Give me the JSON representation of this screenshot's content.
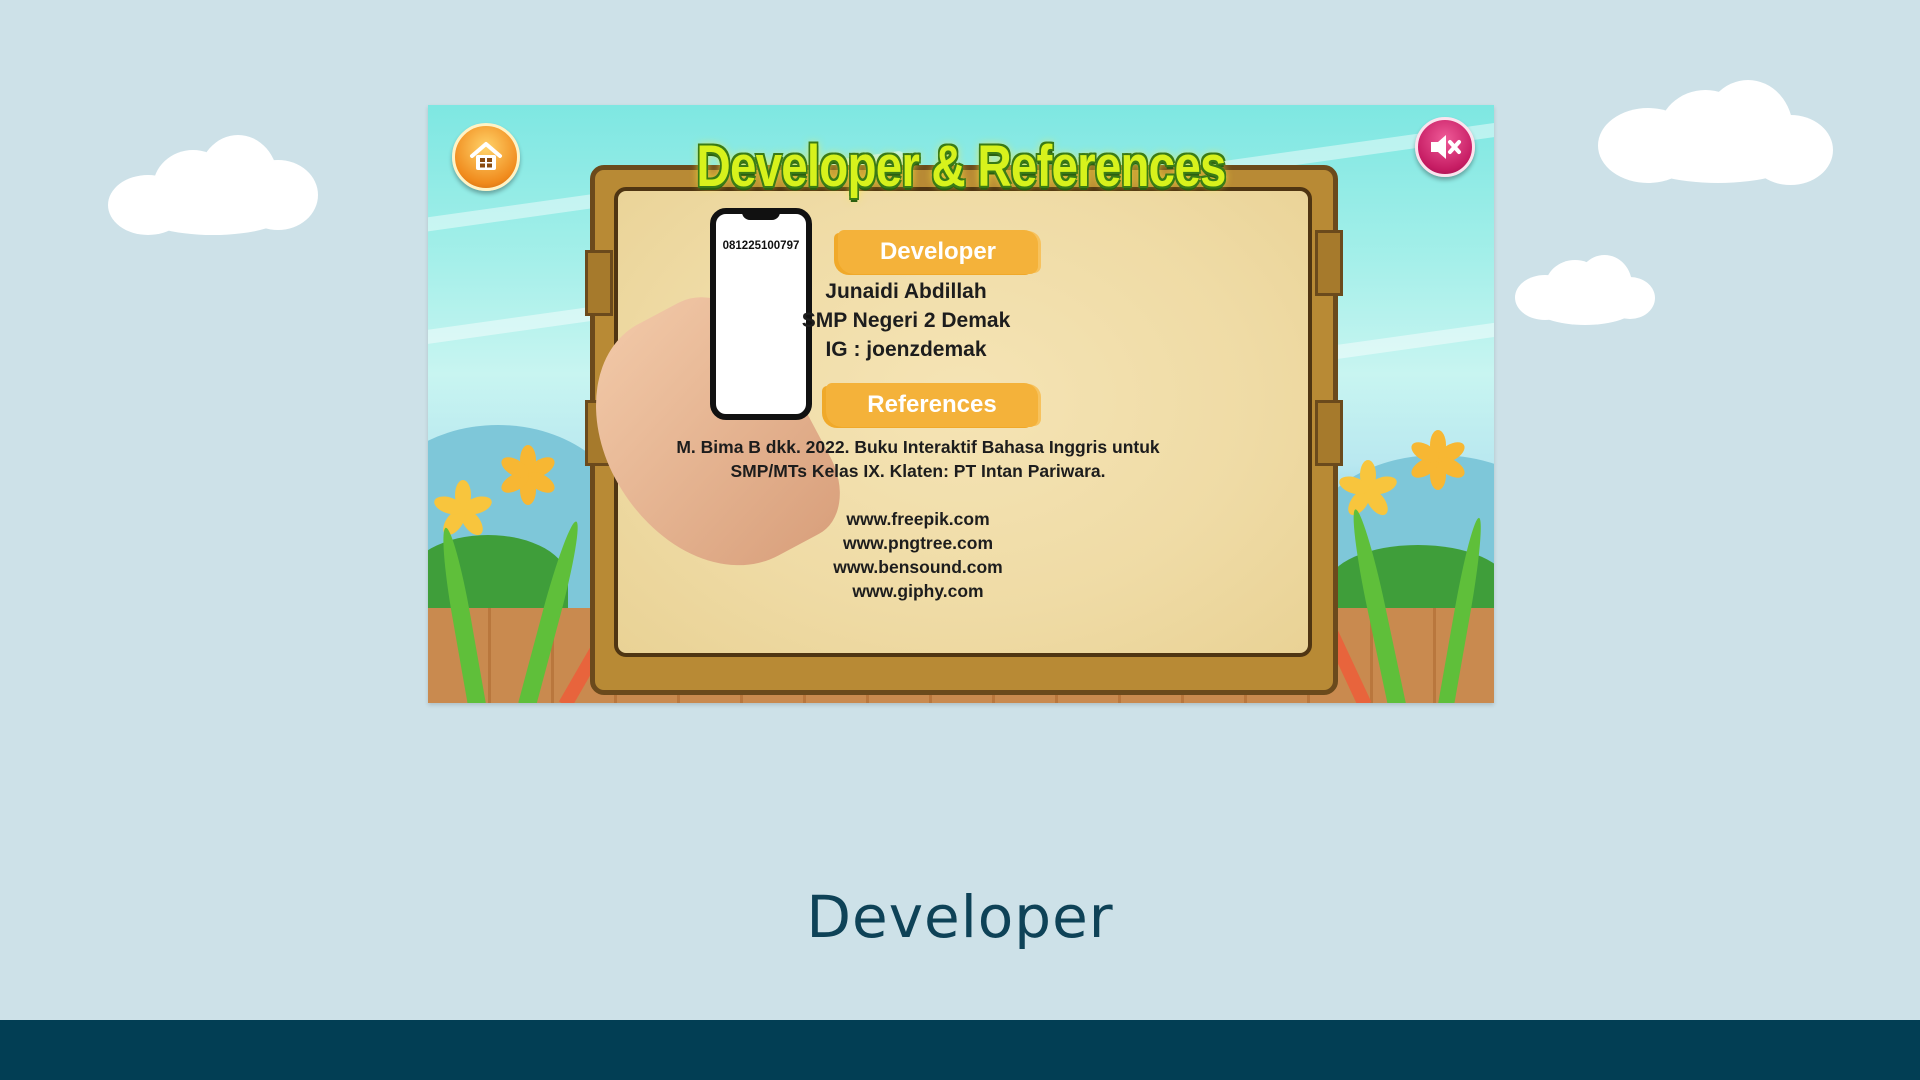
{
  "screen": {
    "title": "Developer & References",
    "home_button": {
      "icon": "home-icon"
    },
    "sound_button": {
      "icon": "speaker-mute-icon"
    },
    "phone_number": "081225100797",
    "developer": {
      "heading": "Developer",
      "name": "Junaidi Abdillah",
      "school": "SMP Negeri 2 Demak",
      "instagram": "IG : joenzdemak"
    },
    "references": {
      "heading": "References",
      "book_line1": "M. Bima B dkk. 2022. Buku Interaktif Bahasa Inggris untuk",
      "book_line2": "SMP/MTs Kelas IX. Klaten: PT Intan Pariwara.",
      "sites": [
        "www.freepik.com",
        "www.pngtree.com",
        "www.bensound.com",
        "www.giphy.com"
      ]
    }
  },
  "slide": {
    "caption": "Developer"
  },
  "colors": {
    "background": "#cde1e8",
    "footer": "#023e54",
    "caption": "#0e4257",
    "badge": "#f4b23a",
    "title": "#d7f21c"
  }
}
